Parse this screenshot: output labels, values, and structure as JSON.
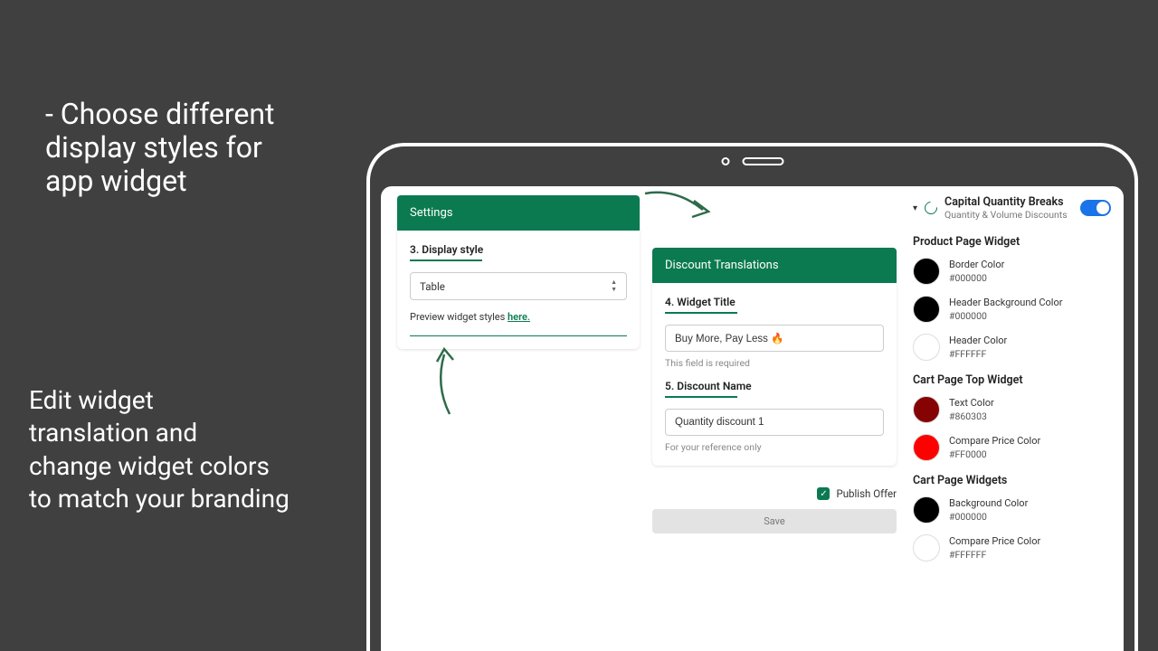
{
  "marketing": {
    "line1": "- Choose different\n  display styles for\n  app widget",
    "line2": "Edit widget\ntranslation and\nchange widget colors\nto match your branding"
  },
  "settings": {
    "panel_title": "Settings",
    "display_style_label": "3. Display style",
    "display_style_value": "Table",
    "preview_prefix": "Preview widget styles ",
    "preview_link": "here."
  },
  "translations": {
    "panel_title": "Discount Translations",
    "widget_title_label": "4. Widget Title",
    "widget_title_value": "Buy More, Pay Less 🔥",
    "widget_title_hint": "This field is required",
    "discount_name_label": "5. Discount Name",
    "discount_name_value": "Quantity discount 1",
    "discount_name_hint": "For your reference only",
    "publish_label": "Publish Offer",
    "save_label": "Save"
  },
  "app": {
    "title": "Capital Quantity Breaks",
    "subtitle": "Quantity & Volume Discounts"
  },
  "widgets": {
    "product_page": {
      "title": "Product Page Widget",
      "colors": [
        {
          "label": "Border Color",
          "hex": "#000000"
        },
        {
          "label": "Header Background Color",
          "hex": "#000000"
        },
        {
          "label": "Header Color",
          "hex": "#FFFFFF"
        }
      ]
    },
    "cart_top": {
      "title": "Cart Page Top Widget",
      "colors": [
        {
          "label": "Text Color",
          "hex": "#860303"
        },
        {
          "label": "Compare Price Color",
          "hex": "#FF0000"
        }
      ]
    },
    "cart_widgets": {
      "title": "Cart Page Widgets",
      "colors": [
        {
          "label": "Background Color",
          "hex": "#000000"
        },
        {
          "label": "Compare Price Color",
          "hex": "#FFFFFF"
        }
      ]
    }
  }
}
